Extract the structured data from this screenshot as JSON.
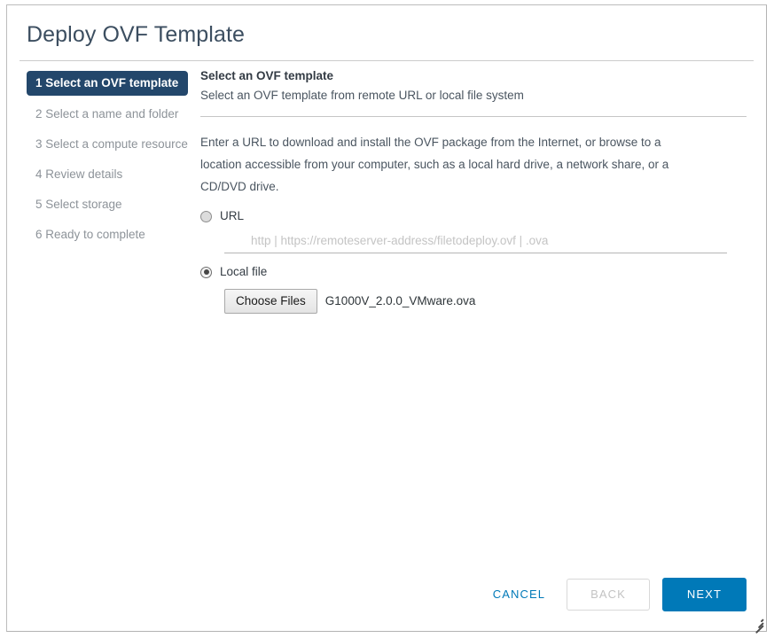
{
  "dialog": {
    "title": "Deploy OVF Template"
  },
  "stepnav": {
    "steps": [
      {
        "label": "1 Select an OVF template",
        "active": true
      },
      {
        "label": "2 Select a name and folder",
        "active": false
      },
      {
        "label": "3 Select a compute resource",
        "active": false
      },
      {
        "label": "4 Review details",
        "active": false
      },
      {
        "label": "5 Select storage",
        "active": false
      },
      {
        "label": "6 Ready to complete",
        "active": false
      }
    ]
  },
  "content": {
    "heading": "Select an OVF template",
    "subheading": "Select an OVF template from remote URL or local file system",
    "description": "Enter a URL to download and install the OVF package from the Internet, or browse to a location accessible from your computer, such as a local hard drive, a network share, or a CD/DVD drive.",
    "url_option": {
      "label": "URL",
      "selected": false,
      "placeholder": "http | https://remoteserver-address/filetodeploy.ovf | .ova",
      "value": ""
    },
    "local_file_option": {
      "label": "Local file",
      "selected": true,
      "button_label": "Choose Files",
      "file_name": "G1000V_2.0.0_VMware.ova"
    }
  },
  "footer": {
    "cancel_label": "CANCEL",
    "back_label": "BACK",
    "next_label": "NEXT"
  },
  "colors": {
    "accent_blue": "#0079b8",
    "active_step_navy": "#23476b",
    "title_slate": "#3c4e60",
    "muted_text": "#8d9399"
  }
}
